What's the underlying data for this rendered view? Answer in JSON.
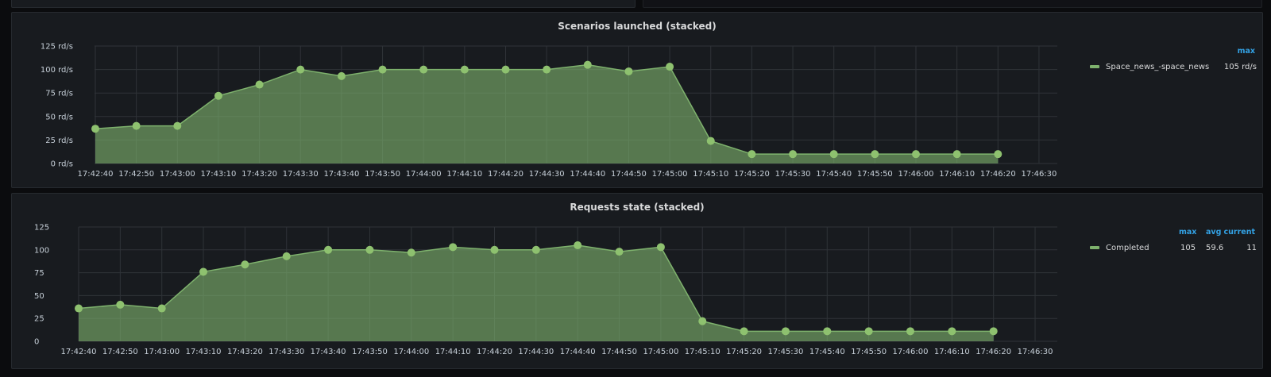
{
  "chart_data": [
    {
      "type": "area",
      "title": "Scenarios launched (stacked)",
      "x": [
        "17:42:40",
        "17:42:50",
        "17:43:00",
        "17:43:10",
        "17:43:20",
        "17:43:30",
        "17:43:40",
        "17:43:50",
        "17:44:00",
        "17:44:10",
        "17:44:20",
        "17:44:30",
        "17:44:40",
        "17:44:50",
        "17:45:00",
        "17:45:10",
        "17:45:20",
        "17:45:30",
        "17:45:40",
        "17:45:50",
        "17:46:00",
        "17:46:10",
        "17:46:20"
      ],
      "x_ticks": [
        "17:42:40",
        "17:42:50",
        "17:43:00",
        "17:43:10",
        "17:43:20",
        "17:43:30",
        "17:43:40",
        "17:43:50",
        "17:44:00",
        "17:44:10",
        "17:44:20",
        "17:44:30",
        "17:44:40",
        "17:44:50",
        "17:45:00",
        "17:45:10",
        "17:45:20",
        "17:45:30",
        "17:45:40",
        "17:45:50",
        "17:46:00",
        "17:46:10",
        "17:46:20",
        "17:46:30"
      ],
      "y_ticks": [
        "125 rd/s",
        "100 rd/s",
        "75 rd/s",
        "50 rd/s",
        "25 rd/s",
        "0 rd/s"
      ],
      "ylim": [
        0,
        125
      ],
      "grid": true,
      "legend_position": "right",
      "series": [
        {
          "name": "Space_news_-space_news",
          "color": "#7eb26d",
          "values": [
            37,
            40,
            40,
            72,
            84,
            100,
            93,
            100,
            100,
            100,
            100,
            100,
            105,
            98,
            103,
            24,
            10,
            10,
            10,
            10,
            10,
            10,
            10
          ]
        }
      ],
      "legend_headers": [
        "max"
      ],
      "legend_rows": [
        {
          "name": "Space_news_-space_news",
          "max": "105 rd/s"
        }
      ]
    },
    {
      "type": "area",
      "title": "Requests state (stacked)",
      "x": [
        "17:42:40",
        "17:42:50",
        "17:43:00",
        "17:43:10",
        "17:43:20",
        "17:43:30",
        "17:43:40",
        "17:43:50",
        "17:44:00",
        "17:44:10",
        "17:44:20",
        "17:44:30",
        "17:44:40",
        "17:44:50",
        "17:45:00",
        "17:45:10",
        "17:45:20",
        "17:45:30",
        "17:45:40",
        "17:45:50",
        "17:46:00",
        "17:46:10",
        "17:46:20"
      ],
      "x_ticks": [
        "17:42:40",
        "17:42:50",
        "17:43:00",
        "17:43:10",
        "17:43:20",
        "17:43:30",
        "17:43:40",
        "17:43:50",
        "17:44:00",
        "17:44:10",
        "17:44:20",
        "17:44:30",
        "17:44:40",
        "17:44:50",
        "17:45:00",
        "17:45:10",
        "17:45:20",
        "17:45:30",
        "17:45:40",
        "17:45:50",
        "17:46:00",
        "17:46:10",
        "17:46:20",
        "17:46:30"
      ],
      "y_ticks": [
        "125",
        "100",
        "75",
        "50",
        "25",
        "0"
      ],
      "ylim": [
        0,
        125
      ],
      "grid": true,
      "legend_position": "right",
      "series": [
        {
          "name": "Completed",
          "color": "#7eb26d",
          "values": [
            36,
            40,
            36,
            76,
            84,
            93,
            100,
            100,
            97,
            103,
            100,
            100,
            105,
            98,
            103,
            22,
            11,
            11,
            11,
            11,
            11,
            11,
            11
          ]
        }
      ],
      "legend_headers": [
        "max",
        "avg",
        "current"
      ],
      "legend_rows": [
        {
          "name": "Completed",
          "max": "105",
          "avg": "59.6",
          "current": "11"
        }
      ]
    }
  ]
}
